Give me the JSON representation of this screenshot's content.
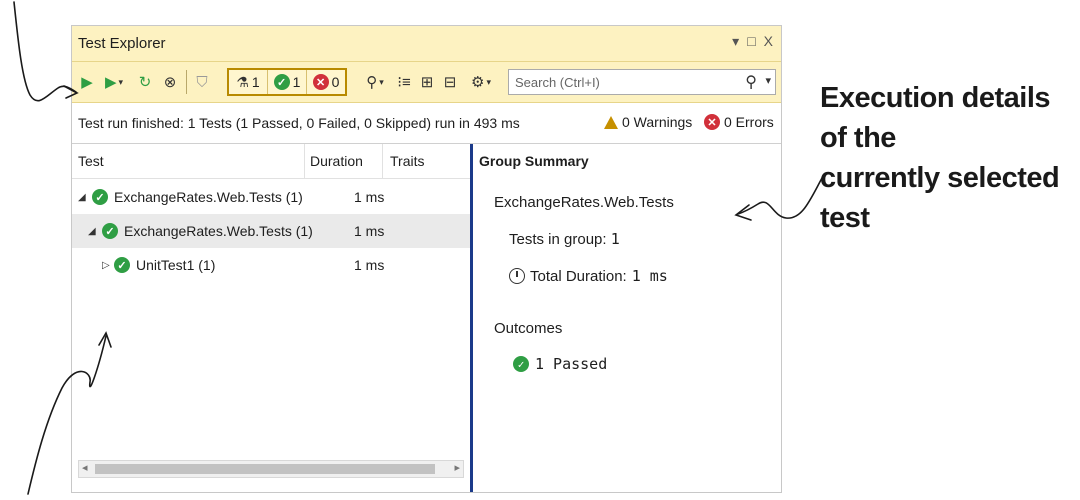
{
  "window": {
    "title": "Test Explorer",
    "controls": [
      "▾",
      "□",
      "X"
    ]
  },
  "toolbar": {
    "counts": {
      "total": "1",
      "passed": "1",
      "failed": "0"
    },
    "search_placeholder": "Search (Ctrl+I)"
  },
  "status": {
    "text": "Test run finished: 1 Tests (1 Passed, 0 Failed, 0 Skipped) run in 493 ms",
    "warnings": "0 Warnings",
    "errors": "0 Errors"
  },
  "tree": {
    "columns": [
      "Test",
      "Duration",
      "Traits"
    ],
    "rows": [
      {
        "name": "ExchangeRates.Web.Tests (1)",
        "duration": "1 ms",
        "expander": "◢"
      },
      {
        "name": "ExchangeRates.Web.Tests (1)",
        "duration": "1 ms",
        "expander": "◢"
      },
      {
        "name": "UnitTest1 (1)",
        "duration": "1 ms",
        "expander": "▷"
      }
    ]
  },
  "summary": {
    "heading": "Group Summary",
    "group_name": "ExchangeRates.Web.Tests",
    "tests_in_group_label": "Tests in group:",
    "tests_in_group_value": "1",
    "total_duration_label": "Total Duration:",
    "total_duration_value": "1 ms",
    "outcomes_label": "Outcomes",
    "passed": "1 Passed"
  },
  "annotation": {
    "line1": "Execution details of the",
    "line2": "currently selected test"
  },
  "colors": {
    "toolbar_bg": "#fdf2c1",
    "pass": "#2f9e44",
    "fail": "#d1303a",
    "splitter": "#1b3a8a"
  }
}
